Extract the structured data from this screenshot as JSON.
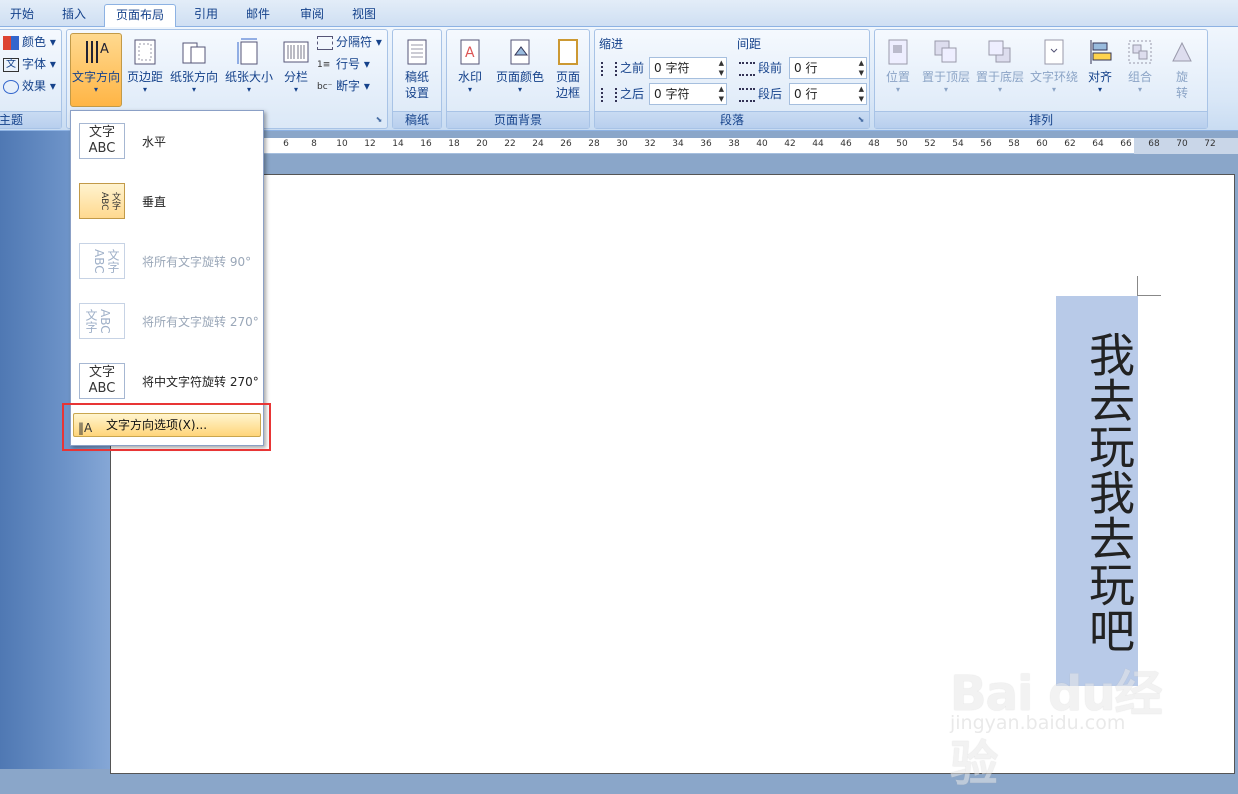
{
  "tabs": [
    "开始",
    "插入",
    "页面布局",
    "引用",
    "邮件",
    "审阅",
    "视图"
  ],
  "active_tab": "页面布局",
  "theme_group": {
    "label": "主题",
    "items": [
      "颜色",
      "字体",
      "效果"
    ]
  },
  "page_setup_group": {
    "buttons": [
      "文字方向",
      "页边距",
      "纸张方向",
      "纸张大小",
      "分栏"
    ],
    "small_items": [
      "分隔符",
      "行号",
      "断字"
    ]
  },
  "manuscript_group": {
    "label": "稿纸",
    "button": "稿纸\n设置"
  },
  "page_bg_group": {
    "label": "页面背景",
    "buttons": [
      "水印",
      "页面颜色",
      "页面\n边框"
    ]
  },
  "paragraph_group": {
    "label": "段落",
    "indent_label": "缩进",
    "spacing_label": "间距",
    "indent_before_label": "之前",
    "indent_before_value": "0 字符",
    "indent_after_label": "之后",
    "indent_after_value": "0 字符",
    "space_before_label": "段前",
    "space_before_value": "0 行",
    "space_after_label": "段后",
    "space_after_value": "0 行"
  },
  "arrange_group": {
    "label": "排列",
    "buttons": [
      "位置",
      "置于顶层",
      "置于底层",
      "文字环绕",
      "对齐",
      "组合",
      "旋\n转"
    ]
  },
  "ruler_ticks": [
    "8",
    "6",
    "8",
    "10",
    "12",
    "14",
    "16",
    "18",
    "20",
    "22",
    "24",
    "26",
    "28",
    "30",
    "32",
    "34",
    "36",
    "38",
    "40",
    "42",
    "44",
    "46",
    "48",
    "50",
    "52",
    "54",
    "56",
    "58",
    "60",
    "62",
    "64",
    "66",
    "68",
    "70",
    "72"
  ],
  "text_direction_menu": {
    "items": [
      {
        "label": "水平",
        "icon_text": "文字\nABC",
        "state": "normal"
      },
      {
        "label": "垂直",
        "icon_text": "文字ABC",
        "state": "selected"
      },
      {
        "label": "将所有文字旋转 90°",
        "icon_text": "文字ABC",
        "state": "disabled"
      },
      {
        "label": "将所有文字旋转 270°",
        "icon_text": "文字ABC",
        "state": "disabled"
      },
      {
        "label": "将中文字符旋转 270°",
        "icon_text": "文字\nABC",
        "state": "normal"
      }
    ],
    "options_label": "文字方向选项(X)..."
  },
  "document": {
    "vertical_text": "我去玩我去玩吧"
  },
  "watermark": {
    "brand": "Bai du经验",
    "url": "jingyan.baidu.com"
  }
}
